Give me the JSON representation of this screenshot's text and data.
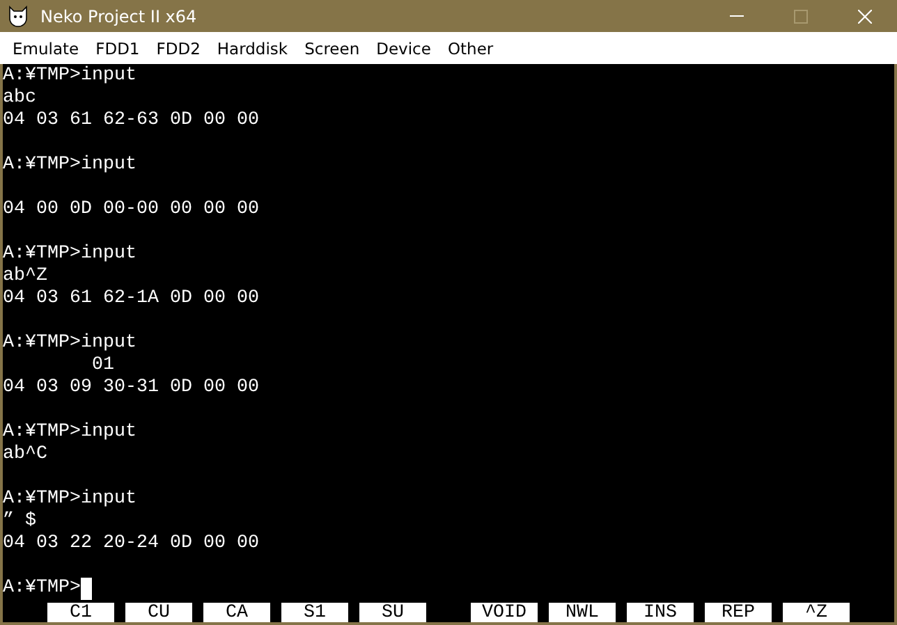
{
  "window": {
    "title": "Neko Project II x64",
    "buttons": [
      {
        "kind": "minimize",
        "disabled": false
      },
      {
        "kind": "maximize",
        "disabled": true
      },
      {
        "kind": "close",
        "disabled": false
      }
    ]
  },
  "menu": [
    "Emulate",
    "FDD1",
    "FDD2",
    "Harddisk",
    "Screen",
    "Device",
    "Other"
  ],
  "terminal": {
    "lines": [
      {
        "kind": "text",
        "text": "A:¥TMP>input"
      },
      {
        "kind": "text",
        "text": "abc"
      },
      {
        "kind": "text",
        "text": "04 03 61 62-63 0D 00 00"
      },
      {
        "kind": "blank"
      },
      {
        "kind": "text",
        "text": "A:¥TMP>input"
      },
      {
        "kind": "blank"
      },
      {
        "kind": "text",
        "text": "04 00 0D 00-00 00 00 00"
      },
      {
        "kind": "blank"
      },
      {
        "kind": "text",
        "text": "A:¥TMP>input"
      },
      {
        "kind": "text",
        "text": "ab^Z"
      },
      {
        "kind": "text",
        "text": "04 03 61 62-1A 0D 00 00"
      },
      {
        "kind": "blank"
      },
      {
        "kind": "text",
        "text": "A:¥TMP>input"
      },
      {
        "kind": "text",
        "text": "        01"
      },
      {
        "kind": "text",
        "text": "04 03 09 30-31 0D 00 00"
      },
      {
        "kind": "blank"
      },
      {
        "kind": "text",
        "text": "A:¥TMP>input"
      },
      {
        "kind": "text",
        "text": "ab^C"
      },
      {
        "kind": "blank"
      },
      {
        "kind": "text",
        "text": "A:¥TMP>input"
      },
      {
        "kind": "text",
        "text": "” $"
      },
      {
        "kind": "text",
        "text": "04 03 22 20-24 0D 00 00"
      },
      {
        "kind": "blank"
      },
      {
        "kind": "prompt",
        "text": "A:¥TMP>",
        "cursor": true
      }
    ],
    "function_key_groups": [
      [
        "C1",
        "CU",
        "CA",
        "S1",
        "SU"
      ],
      [
        "VOID",
        "NWL",
        "INS",
        "REP",
        "^Z"
      ]
    ]
  }
}
